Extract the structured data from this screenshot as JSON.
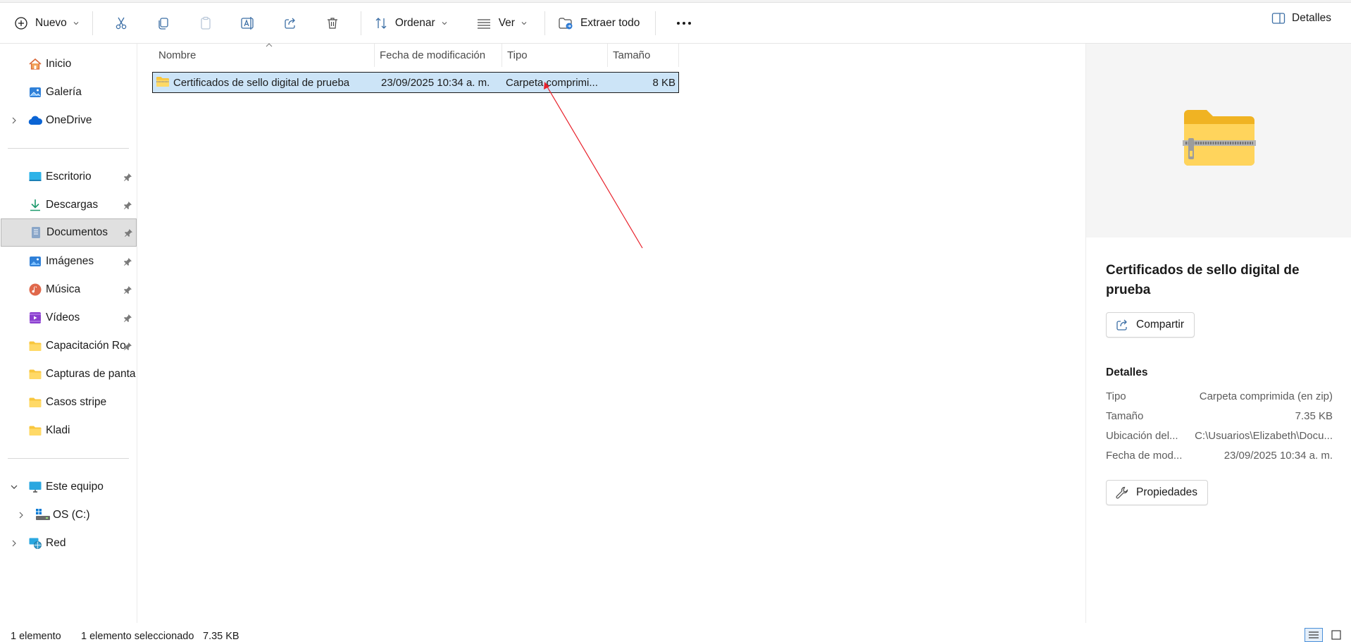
{
  "toolbar": {
    "new_label": "Nuevo",
    "sort_label": "Ordenar",
    "view_label": "Ver",
    "extract_label": "Extraer todo",
    "details_label": "Detalles"
  },
  "nav": {
    "items": [
      {
        "label": "Inicio",
        "icon": "home-icon"
      },
      {
        "label": "Galería",
        "icon": "gallery-icon"
      },
      {
        "label": "OneDrive",
        "icon": "cloud-icon"
      },
      {
        "label": "Escritorio",
        "icon": "desktop-icon"
      },
      {
        "label": "Descargas",
        "icon": "download-icon"
      },
      {
        "label": "Documentos",
        "icon": "documents-icon"
      },
      {
        "label": "Imágenes",
        "icon": "pictures-icon"
      },
      {
        "label": "Música",
        "icon": "music-icon"
      },
      {
        "label": "Vídeos",
        "icon": "videos-icon"
      },
      {
        "label": "Capacitación Ro",
        "icon": "folder-icon"
      },
      {
        "label": "Capturas de pantall",
        "icon": "folder-icon"
      },
      {
        "label": "Casos stripe",
        "icon": "folder-icon"
      },
      {
        "label": "Kladi",
        "icon": "folder-icon"
      },
      {
        "label": "Este equipo",
        "icon": "computer-icon"
      },
      {
        "label": "OS (C:)",
        "icon": "drive-icon"
      },
      {
        "label": "Red",
        "icon": "network-icon"
      }
    ]
  },
  "list": {
    "columns": [
      "Nombre",
      "Fecha de modificación",
      "Tipo",
      "Tamaño"
    ],
    "rows": [
      {
        "name": "Certificados de sello digital de prueba",
        "date": "23/09/2025 10:34 a. m.",
        "type": "Carpeta comprimi...",
        "size": "8 KB"
      }
    ]
  },
  "details": {
    "title": "Certificados de sello digital de prueba",
    "share_label": "Compartir",
    "section_label": "Detalles",
    "props": [
      {
        "key": "Tipo",
        "value": "Carpeta comprimida (en zip)"
      },
      {
        "key": "Tamaño",
        "value": "7.35 KB"
      },
      {
        "key": "Ubicación del...",
        "value": "C:\\Usuarios\\Elizabeth\\Docu..."
      },
      {
        "key": "Fecha de mod...",
        "value": "23/09/2025 10:34 a. m."
      }
    ],
    "properties_label": "Propiedades"
  },
  "status": {
    "count": "1 elemento",
    "selected": "1 elemento seleccionado",
    "size": "7.35 KB"
  },
  "colors": {
    "selection_bg": "#cce4f7",
    "accent": "#0067c0",
    "annotation_arrow": "#e8202a",
    "folder_yellow": "#f8c63d"
  }
}
